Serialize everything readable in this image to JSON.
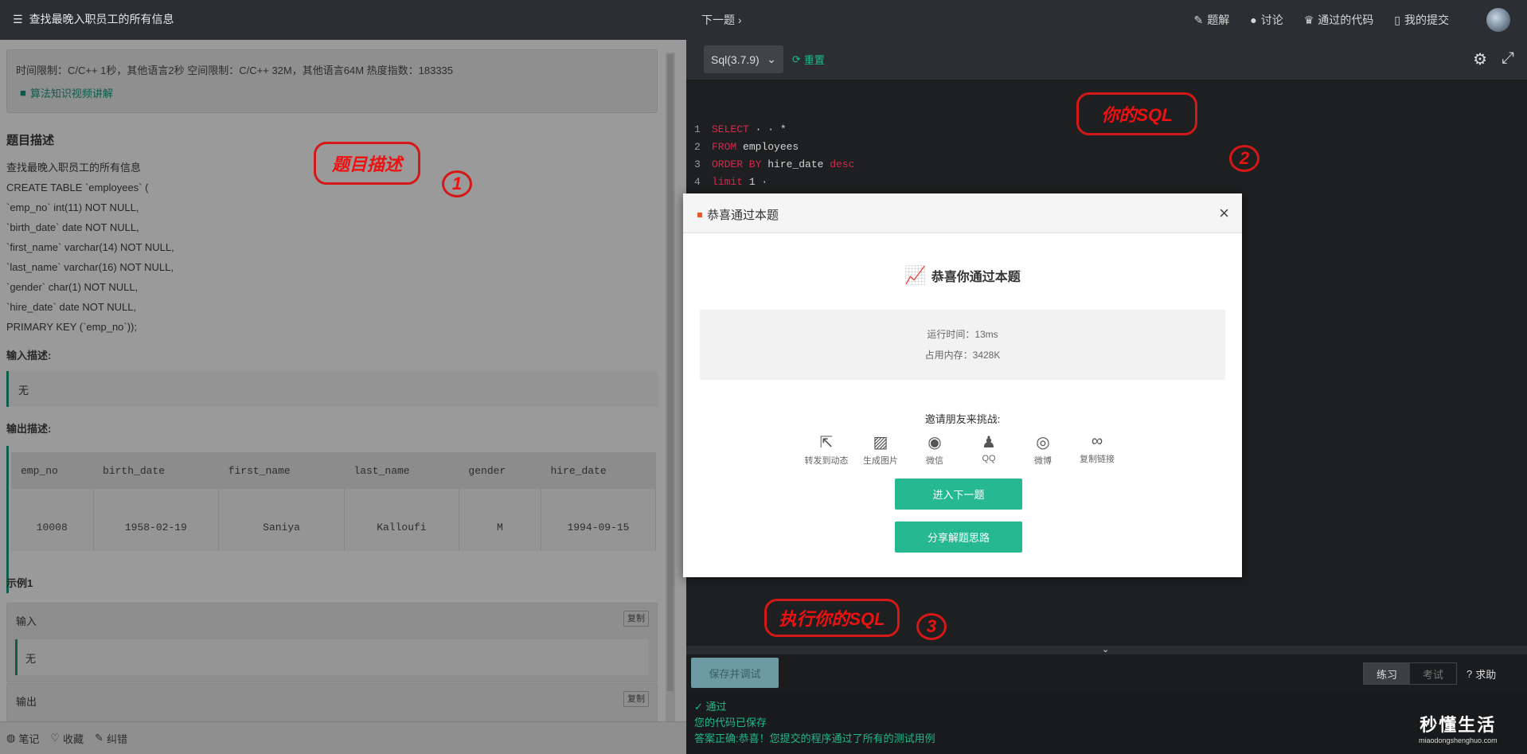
{
  "header": {
    "title": "查找最晚入职员工的所有信息",
    "next": "下一题",
    "nav": [
      "题解",
      "讨论",
      "通过的代码",
      "我的提交"
    ]
  },
  "problem": {
    "limits": "时间限制：C/C++ 1秒，其他语言2秒   空间限制：C/C++ 32M，其他语言64M   热度指数：183335",
    "video": "算法知识视频讲解",
    "section_title": "题目描述",
    "desc_lines": [
      "查找最晚入职员工的所有信息",
      "CREATE TABLE `employees` (",
      "`emp_no` int(11) NOT NULL,",
      "`birth_date` date NOT NULL,",
      "`first_name` varchar(14) NOT NULL,",
      "`last_name` varchar(16) NOT NULL,",
      "`gender` char(1) NOT NULL,",
      "`hire_date` date NOT NULL,",
      "PRIMARY KEY (`emp_no`));"
    ],
    "input_label": "输入描述:",
    "input_value": "无",
    "output_label": "输出描述:",
    "table_headers": [
      "emp_no",
      "birth_date",
      "first_name",
      "last_name",
      "gender",
      "hire_date"
    ],
    "table_row": [
      "10008",
      "1958-02-19",
      "Saniya",
      "Kalloufi",
      "M",
      "1994-09-15"
    ],
    "example_title": "示例1",
    "ex_input_label": "输入",
    "ex_input_value": "无",
    "ex_output_label": "输出",
    "copy": "复制",
    "footer": [
      "笔记",
      "收藏",
      "纠错"
    ]
  },
  "annotations": {
    "desc": "题目描述",
    "sql": "你的SQL",
    "run": "执行你的SQL",
    "n1": "1",
    "n2": "2",
    "n3": "3"
  },
  "editor": {
    "language": "Sql(3.7.9)",
    "reset": "重置",
    "lines": [
      {
        "n": "1",
        "kw": "SELECT",
        "rest": " · · *"
      },
      {
        "n": "2",
        "kw": "FROM",
        "rest": " employees"
      },
      {
        "n": "3",
        "kw": "ORDER BY",
        "rest": " hire_date ",
        "kw2": "desc"
      },
      {
        "n": "4",
        "kw": "limit",
        "rest": " 1 ·"
      }
    ]
  },
  "bottom": {
    "save": "保存并调试",
    "practice": "练习",
    "exam": "考试",
    "help": "求助",
    "pass": "通过",
    "saved": "您的代码已保存",
    "correct": "答案正确:恭喜！您提交的程序通过了所有的测试用例"
  },
  "modal": {
    "title": "恭喜通过本题",
    "big": "恭喜你通过本题",
    "time": "运行时间：13ms",
    "mem": "占用内存：3428K",
    "invite": "邀请朋友来挑战:",
    "share": [
      "转发到动态",
      "生成图片",
      "微信",
      "QQ",
      "微博",
      "复制链接"
    ],
    "next_btn": "进入下一题",
    "share_btn": "分享解题思路"
  },
  "watermark": {
    "title": "秒懂生活",
    "url": "miaodongshenghuo.com"
  }
}
